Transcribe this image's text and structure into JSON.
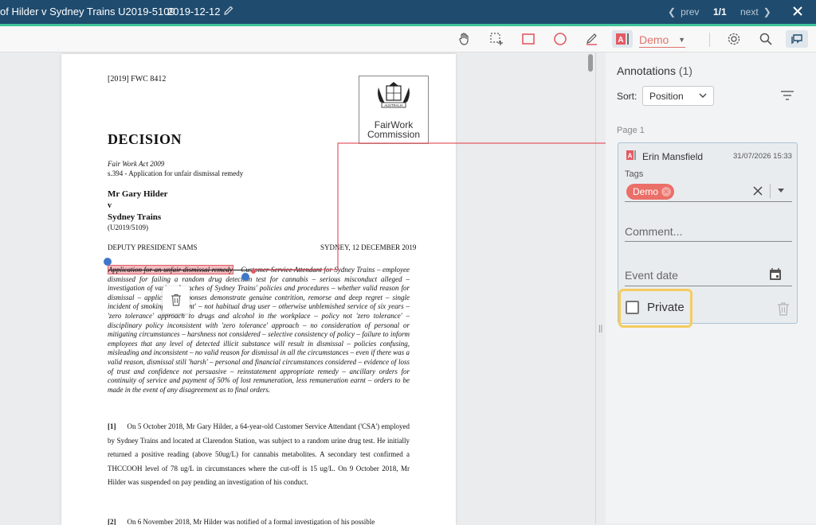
{
  "titlebar": {
    "title": "of Hilder v Sydney Trains U2019-5109",
    "date": "2019-12-12",
    "prev_label": "prev",
    "page_indicator": "1/1",
    "next_label": "next"
  },
  "toolbar": {
    "author_select": "Demo"
  },
  "document": {
    "citation": "[2019] FWC 8412",
    "logo_line1": "FairWork",
    "logo_line2": "Commission",
    "logo_text": "AUSTRALIA",
    "heading": "DECISION",
    "act": "Fair Work Act 2009",
    "section": "s.394 - Application for unfair dismissal remedy",
    "party1": "Mr Gary Hilder",
    "v": "v",
    "party2": "Sydney Trains",
    "matter_no": "(U2019/5109)",
    "member": "DEPUTY PRESIDENT SAMS",
    "place_date": "SYDNEY, 12 DECEMBER 2019",
    "catch_highlight": "Application for an unfair dismissal remedy",
    "catch_struck": " – Customer Service Attendant",
    "catch_rest": " for Sydney Trains – employee dismissed for failing a random drug detection test for cannabis – serious misconduct alleged – investigation of various breaches of Sydney Trains' policies and procedures – whether valid reason for dismissal – applicant's responses demonstrate genuine contrition, remorse and deep regret – single incident of smoking one 'joint' – not habitual drug user – otherwise unblemished service of six years – 'zero tolerance' approach to drugs and alcohol in the workplace – policy not 'zero tolerance' – disciplinary policy inconsistent with 'zero tolerance' approach – no consideration of personal or mitigating circumstances – harshness not considered – selective consistency of policy – failure to inform employees that any level of detected illicit substance will result in dismissal – policies confusing, misleading and inconsistent – no valid reason for dismissal in all the circumstances – even if there was a valid reason, dismissal still 'harsh' – personal and financial circumstances considered – evidence of loss of trust and confidence not persuasive – reinstatement appropriate remedy – ancillary orders for continuity of service and payment of 50% of lost remuneration, less remuneration earnt – orders to be made in the event of any disagreement as to final orders.",
    "p1_num": "[1]",
    "p1_text": "On 5 October 2018, Mr Gary Hilder, a 64-year-old Customer Service Attendant ('CSA') employed by Sydney Trains and located at Clarendon Station, was subject to a random urine drug test. He initially returned a positive reading (above 50ug/L) for cannabis metabolites. A secondary test confirmed a THCCOOH level of 78 ug/L in circumstances where the cut-off is 15 ug/L. On 9 October 2018, Mr Hilder was suspended on pay pending an investigation of his conduct.",
    "p2_num": "[2]",
    "p2_text": "On 6 November 2018, Mr Hilder was notified of a formal investigation of his possible"
  },
  "panel": {
    "title": "Annotations",
    "count": "(1)",
    "sort_label": "Sort:",
    "sort_value": "Position",
    "page_label": "Page 1",
    "card": {
      "author": "Erin Mansfield",
      "timestamp": "31/07/2026 15:33",
      "tags_label": "Tags",
      "tag": "Demo",
      "comment_placeholder": "Comment...",
      "event_date_placeholder": "Event date",
      "private_label": "Private"
    }
  },
  "colors": {
    "titlebar": "#1f4b6e",
    "accent": "#3fc49a",
    "annotation": "#e35a63",
    "highlight_box": "#f5cd5f"
  }
}
